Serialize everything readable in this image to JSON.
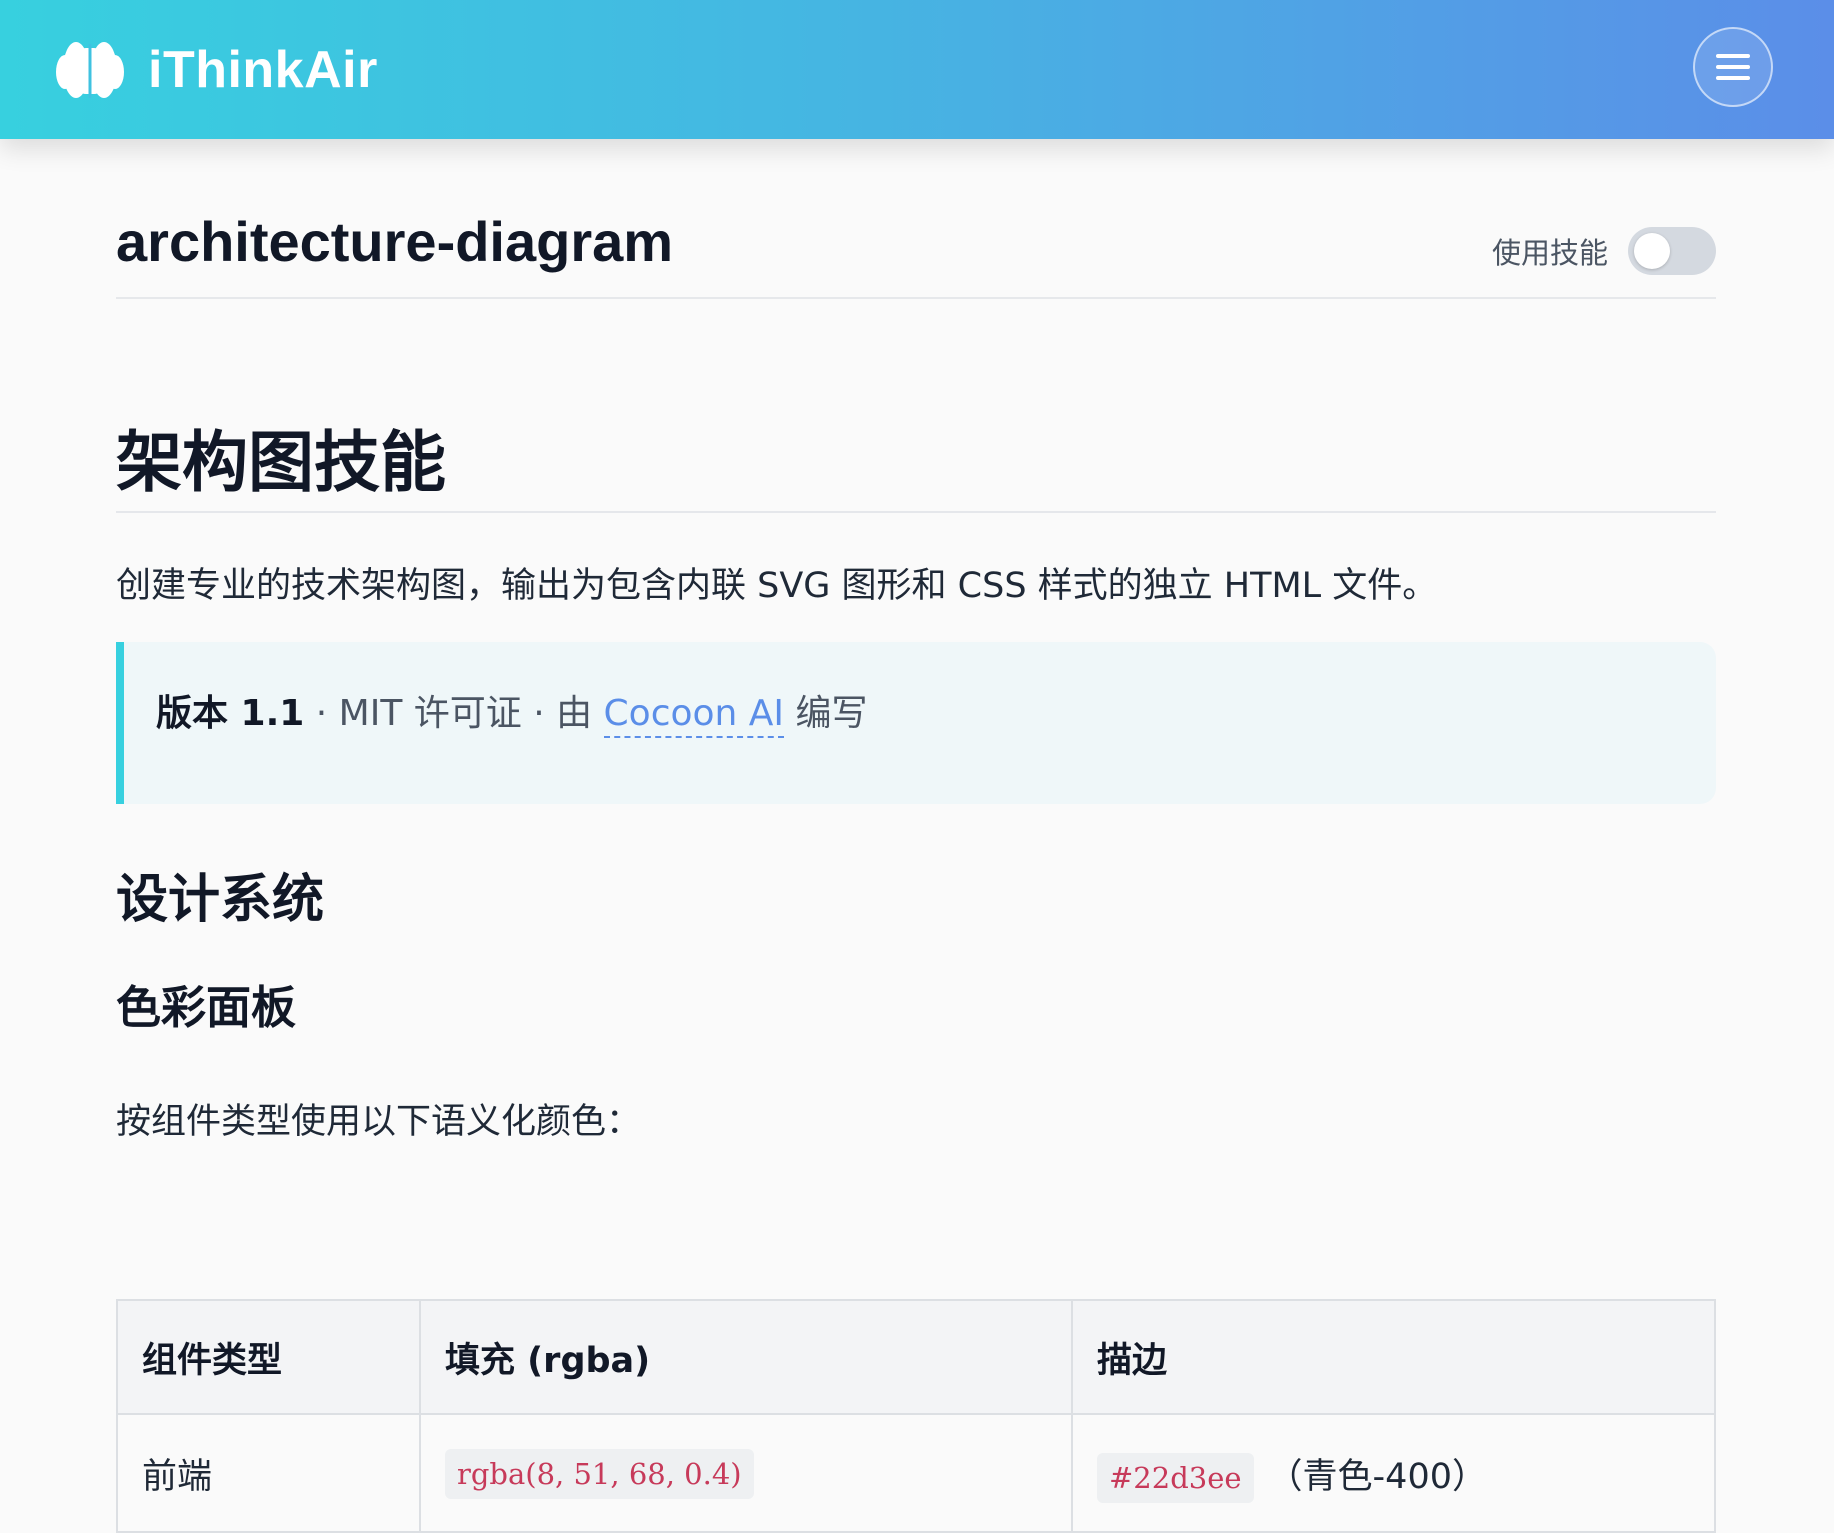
{
  "header": {
    "brand_name": "iThinkAir",
    "logo_icon": "brain-icon",
    "menu_icon": "hamburger-icon",
    "gradient_start": "#37d0df",
    "gradient_end": "#5b8ee8"
  },
  "skill": {
    "id": "architecture-diagram",
    "toggle_label": "使用技能",
    "toggle_on": false
  },
  "article": {
    "title": "架构图技能",
    "intro": "创建专业的技术架构图，输出为包含内联 SVG 图形和 CSS 样式的独立 HTML 文件。",
    "callout": {
      "version": "版本 1.1",
      "license": " · MIT 许可证 · 由 ",
      "author": "Cocoon AI",
      "suffix": " 编写",
      "accent_color": "#37d0df"
    },
    "section_title": "设计系统",
    "subsection_title": "色彩面板",
    "palette_desc": "按组件类型使用以下语义化颜色：",
    "table": {
      "headers": [
        "组件类型",
        "填充 (rgba)",
        "描边"
      ],
      "rows": [
        {
          "type": "前端",
          "fill": "rgba(8, 51, 68, 0.4)",
          "stroke": "#22d3ee",
          "stroke_note": "（青色-400）"
        }
      ]
    }
  }
}
